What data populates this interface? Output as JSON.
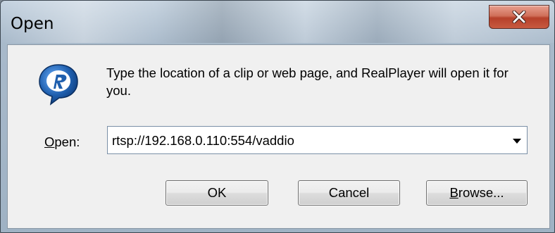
{
  "window": {
    "title": "Open"
  },
  "message": "Type the location of a clip or web page, and RealPlayer will open it for you.",
  "open_field": {
    "label_accel": "O",
    "label_rest": "pen:",
    "value": "rtsp://192.168.0.110:554/vaddio"
  },
  "buttons": {
    "ok": "OK",
    "cancel": "Cancel",
    "browse_accel": "B",
    "browse_rest": "rowse..."
  },
  "icons": {
    "app": "realplayer-logo-icon",
    "close": "close-icon",
    "dropdown": "chevron-down-icon"
  },
  "colors": {
    "close_button": "#c85a40",
    "logo_blue": "#1f5fae"
  }
}
